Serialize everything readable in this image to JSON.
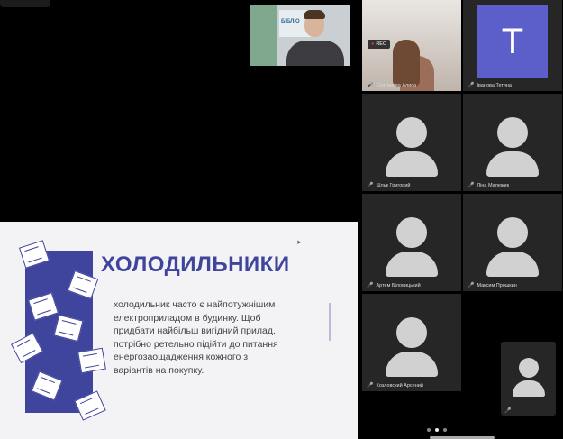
{
  "speaker": {
    "banner_text": "БІБЛІО"
  },
  "slide": {
    "title": "ХОЛОДИЛЬНИКИ",
    "body": "холодильник часто є найпотужнішим електроприладом в будинку. Щоб придбати найбільш вигідний прилад, потрібно ретельно підійти до питання енергозаощадження кожного з варіантів на покупку."
  },
  "participants": [
    {
      "name": "Султанова Алиса",
      "muted": true,
      "badge": "REC"
    },
    {
      "name": "Іванова Тетяна",
      "muted": true,
      "initial": "T"
    },
    {
      "name": "Шльк Григорий",
      "muted": true
    },
    {
      "name": "Ліна Малежик",
      "muted": true
    },
    {
      "name": "Артем Біловицький",
      "muted": true
    },
    {
      "name": "Максим Прошкин",
      "muted": true
    },
    {
      "name": "Козловский Арсений",
      "muted": true
    }
  ],
  "pager": {
    "pages": 3,
    "current": 2
  },
  "icons": {
    "mic_off": "mic-off-icon"
  },
  "colors": {
    "accent": "#3f449c",
    "letter_tile": "#5c5fc9",
    "muted": "#e5352b"
  }
}
